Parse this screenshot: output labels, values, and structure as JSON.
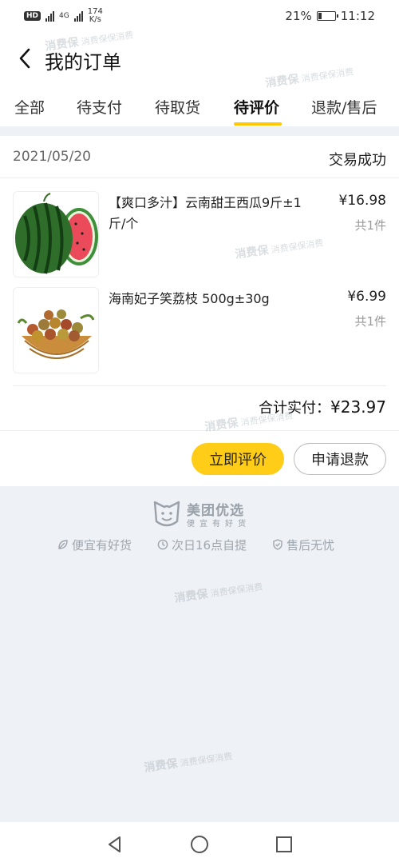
{
  "status_bar": {
    "hd": "HD",
    "net": "4G",
    "speed_value": "174",
    "speed_unit": "K/s",
    "battery": "21%",
    "battery_level": 0.21,
    "time": "11:12"
  },
  "header": {
    "title": "我的订单"
  },
  "tabs": [
    {
      "label": "全部",
      "active": false
    },
    {
      "label": "待支付",
      "active": false
    },
    {
      "label": "待取货",
      "active": false
    },
    {
      "label": "待评价",
      "active": true
    },
    {
      "label": "退款/售后",
      "active": false
    }
  ],
  "order": {
    "date": "2021/05/20",
    "status": "交易成功",
    "items": [
      {
        "name": "【爽口多汁】云南甜王西瓜9斤±1斤/个",
        "price": "¥16.98",
        "qty": "共1件",
        "image": "watermelon"
      },
      {
        "name": "海南妃子笑荔枝 500g±30g",
        "price": "¥6.99",
        "qty": "共1件",
        "image": "lychee-basket"
      }
    ],
    "total_label": "合计实付：",
    "total_value": "¥23.97",
    "buttons": {
      "review": "立即评价",
      "refund": "申请退款"
    }
  },
  "brand": {
    "name": "美团优选",
    "slogan": "便宜有好货"
  },
  "guarantees": [
    {
      "icon": "leaf-icon",
      "label": "便宜有好货"
    },
    {
      "icon": "clock-icon",
      "label": "次日16点自提"
    },
    {
      "icon": "shield-icon",
      "label": "售后无忧"
    }
  ],
  "watermark": "消费保",
  "watermark_sub": "消费保保消费",
  "colors": {
    "accent": "#ffcc17",
    "tab_indicator": "#ffc800",
    "background": "#eef1f5"
  }
}
